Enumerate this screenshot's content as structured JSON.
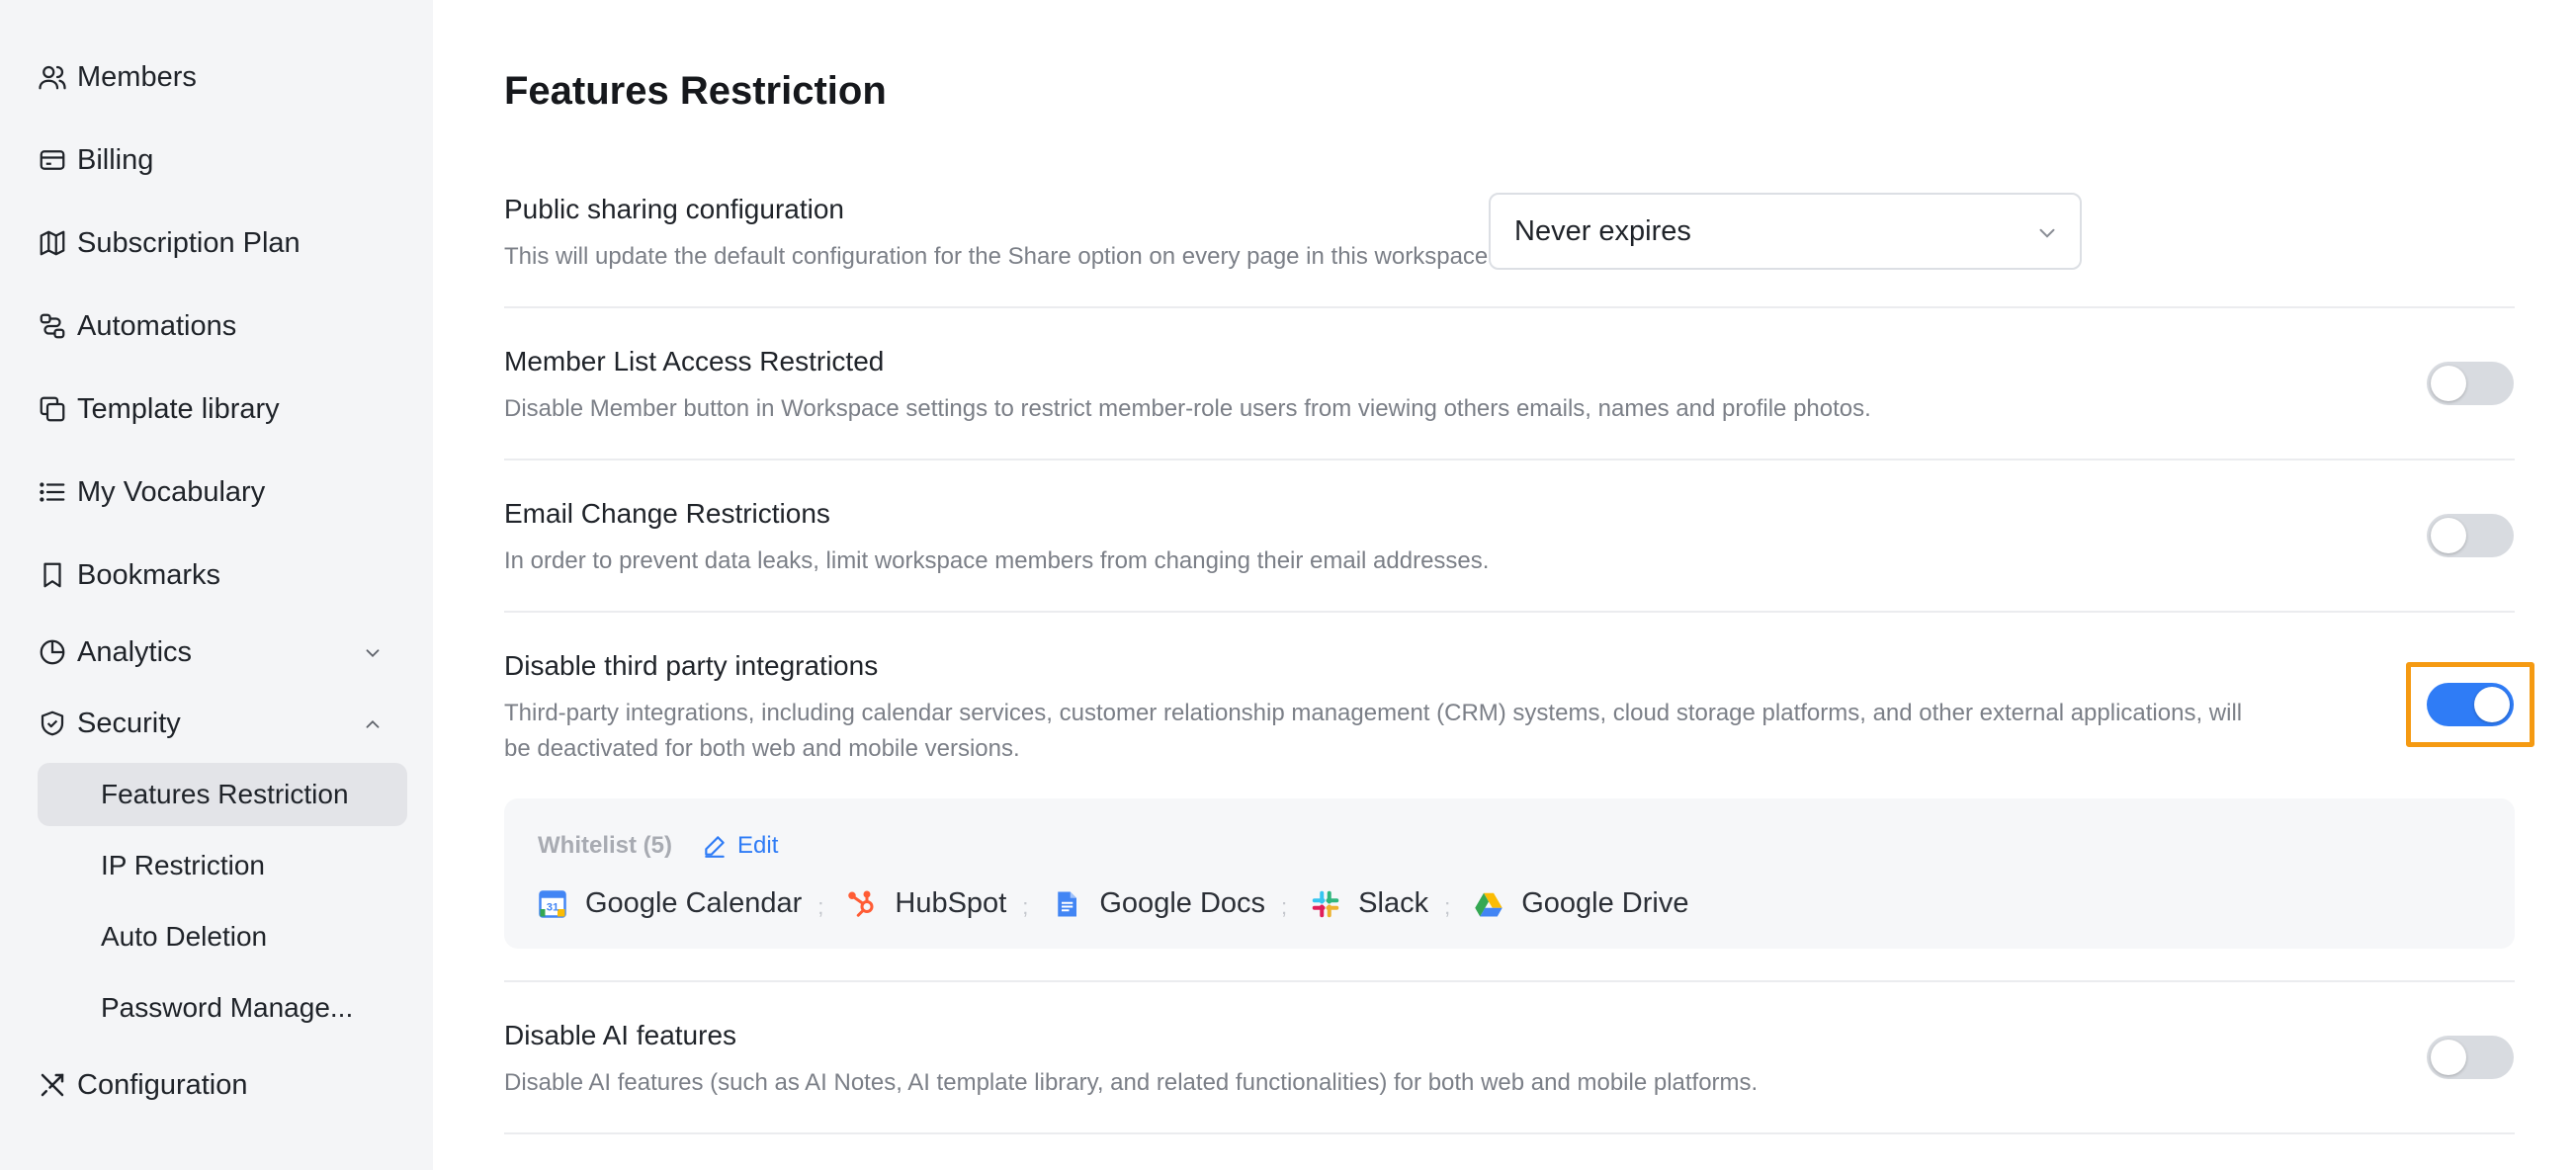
{
  "sidebar": {
    "items": [
      {
        "label": "Members",
        "icon": "users-icon"
      },
      {
        "label": "Billing",
        "icon": "credit-card-icon"
      },
      {
        "label": "Subscription Plan",
        "icon": "map-icon"
      },
      {
        "label": "Automations",
        "icon": "workflow-icon"
      },
      {
        "label": "Template library",
        "icon": "copy-icon"
      },
      {
        "label": "My Vocabulary",
        "icon": "list-icon"
      },
      {
        "label": "Bookmarks",
        "icon": "bookmark-icon"
      },
      {
        "label": "Analytics",
        "icon": "pie-chart-icon",
        "expanded": false
      },
      {
        "label": "Security",
        "icon": "shield-icon",
        "expanded": true
      },
      {
        "label": "Configuration",
        "icon": "tools-icon"
      }
    ],
    "security_sub": [
      {
        "label": "Features Restriction",
        "active": true
      },
      {
        "label": "IP Restriction"
      },
      {
        "label": "Auto Deletion"
      },
      {
        "label": "Password Manage..."
      }
    ]
  },
  "main": {
    "title": "Features Restriction",
    "public_sharing": {
      "title": "Public sharing configuration",
      "desc": "This will update the default configuration for the Share option on every page in this workspace.",
      "select_value": "Never expires"
    },
    "member_list": {
      "title": "Member List Access Restricted",
      "desc": "Disable Member button in Workspace settings to restrict member-role users from viewing others emails, names and profile photos.",
      "enabled": false
    },
    "email_change": {
      "title": "Email Change Restrictions",
      "desc": "In order to prevent data leaks, limit workspace members from changing their email addresses.",
      "enabled": false
    },
    "third_party": {
      "title": "Disable third party integrations",
      "desc_line1": "Third-party integrations, including calendar services, customer relationship management (CRM) systems, cloud storage platforms, and other external applications, will",
      "desc_line2": "be deactivated for both web and mobile versions.",
      "enabled": true,
      "whitelist_label": "Whitelist (5)",
      "edit_label": "Edit",
      "apps": [
        {
          "name": "Google Calendar",
          "icon": "google-calendar-icon"
        },
        {
          "name": "HubSpot",
          "icon": "hubspot-icon"
        },
        {
          "name": "Google Docs",
          "icon": "google-docs-icon"
        },
        {
          "name": "Slack",
          "icon": "slack-icon"
        },
        {
          "name": "Google Drive",
          "icon": "google-drive-icon"
        }
      ],
      "separator": ";"
    },
    "ai_features": {
      "title": "Disable AI features",
      "desc": "Disable AI features (such as AI Notes, AI template library, and related functionalities) for both web and mobile platforms.",
      "enabled": false
    }
  },
  "colors": {
    "accent": "#2f7cf6",
    "highlight": "#f59a12",
    "sidebar_bg": "#f4f5f7",
    "active_bg": "#e3e4e8"
  }
}
